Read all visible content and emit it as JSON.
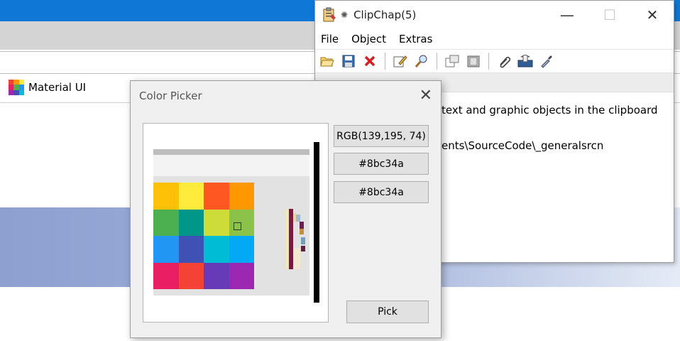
{
  "browser": {
    "bookmark_label": "Material UI"
  },
  "clipchap": {
    "title": "ClipChap(5)",
    "menu": {
      "file": "File",
      "object": "Object",
      "extras": "Extras"
    },
    "body_line1": "text and graphic objects in the clipboard",
    "body_line2": "ents\\SourceCode\\_generalsrcn"
  },
  "color_picker": {
    "title": "Color Picker",
    "rgb_value": "RGB(139,195, 74)",
    "hex_value_1": "#8bc34a",
    "hex_value_2": "#8bc34a",
    "pick_label": "Pick",
    "swatches": [
      [
        "#ffc107",
        "#ffeb3b",
        "#ff5722",
        "#ff9800"
      ],
      [
        "#4caf50",
        "#009688",
        "#cddc39",
        "#8bc34a"
      ],
      [
        "#2196f3",
        "#3f51b5",
        "#00bcd4",
        "#03a9f4"
      ],
      [
        "#e91e63",
        "#f44336",
        "#673ab7",
        "#9c27b0"
      ]
    ]
  },
  "icons": {
    "app": "clipboard-icon",
    "close": "close-icon",
    "minimize": "minimize-icon",
    "maximize": "maximize-icon"
  },
  "colors": {
    "browser_titlebar": "#0f78d6",
    "selected_color": "#8bc34a"
  }
}
